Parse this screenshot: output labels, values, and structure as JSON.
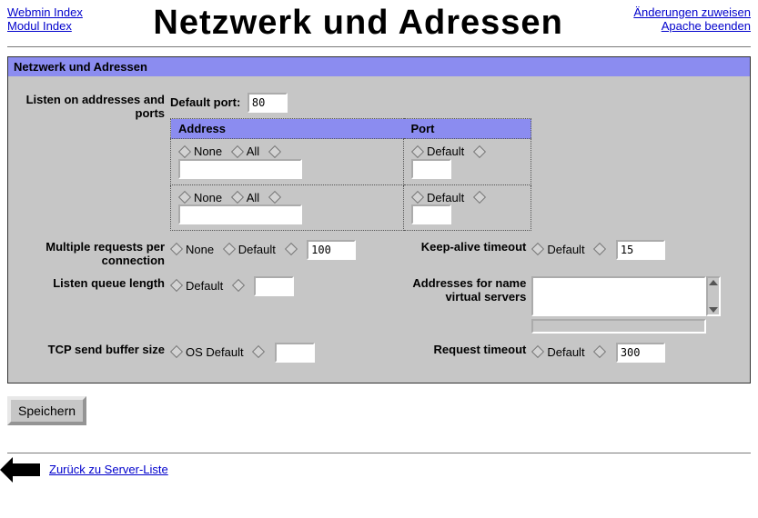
{
  "nav": {
    "webmin_index": "Webmin Index",
    "modul_index": "Modul Index",
    "apply_changes": "Änderungen zuweisen",
    "stop_apache": "Apache beenden"
  },
  "page_title": "Netzwerk und Adressen",
  "section_title": "Netzwerk und Adressen",
  "labels": {
    "listen_addresses": "Listen on addresses and ports",
    "default_port": "Default port:",
    "address_col": "Address",
    "port_col": "Port",
    "none": "None",
    "all": "All",
    "default": "Default",
    "multiple_requests": "Multiple requests per connection",
    "keepalive_timeout": "Keep-alive timeout",
    "listen_queue": "Listen queue length",
    "name_virtual": "Addresses for name virtual servers",
    "tcp_send_buffer": "TCP send buffer size",
    "os_default": "OS Default",
    "request_timeout": "Request timeout"
  },
  "values": {
    "default_port": "80",
    "addr_rows": [
      {
        "addr": "",
        "port": ""
      },
      {
        "addr": "",
        "port": ""
      }
    ],
    "multiple_requests": "100",
    "keepalive_timeout": "15",
    "listen_queue": "",
    "name_virtual": "",
    "tcp_send_buffer": "",
    "request_timeout": "300"
  },
  "buttons": {
    "save": "Speichern"
  },
  "footer": {
    "back": "Zurück zu Server-Liste"
  }
}
